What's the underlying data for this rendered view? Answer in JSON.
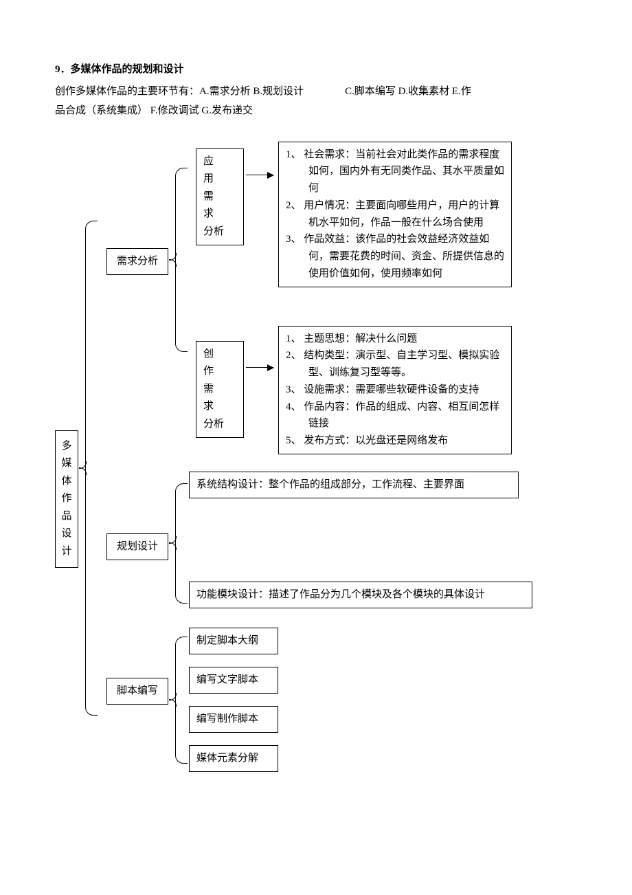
{
  "heading": "9．多媒体作品的规划和设计",
  "intro_prefix": "创作多媒体作品的主要环节有：A.需求分析 B.规划设计",
  "intro_c": "C.脚本编写 D.收集素材 E.作",
  "intro_line2": "品合成（系统集成）   F.修改调试 G.发布递交",
  "root": "多媒体作品设计",
  "n1": {
    "label": "需求分析"
  },
  "n2": {
    "label": "规划设计"
  },
  "n3": {
    "label": "脚本编写"
  },
  "app": {
    "title_l1": "应　用",
    "title_l2": "需　求",
    "title_l3": "分析",
    "items": [
      "1、 社会需求：当前社会对此类作品的需求程度如何，国内外有无同类作品、其水平质量如何",
      "2、 用户情况：主要面向哪些用户，用户的计算机水平如何，作品一般在什么场合使用",
      "3、 作品效益：该作品的社会效益经济效益如何，需要花费的时间、资金、所提供信息的使用价值如何，使用频率如何"
    ]
  },
  "create": {
    "title_l1": "创　作",
    "title_l2": "需　求",
    "title_l3": "分析",
    "items": [
      "1、 主题思想：解决什么问题",
      "2、 结构类型：演示型、自主学习型、模拟实验型、训练复习型等等。",
      "3、 设施需求：需要哪些软硬件设备的支持",
      "4、 作品内容：作品的组成、内容、相互间怎样链接",
      "5、 发布方式：以光盘还是网络发布"
    ]
  },
  "plan": {
    "a": "系统结构设计：整个作品的组成部分，工作流程、主要界面",
    "b": "功能模块设计：描述了作品分为几个模块及各个模块的具体设计"
  },
  "script": {
    "a": "制定脚本大纲",
    "b": "编写文字脚本",
    "c": "编写制作脚本",
    "d": "媒体元素分解"
  }
}
